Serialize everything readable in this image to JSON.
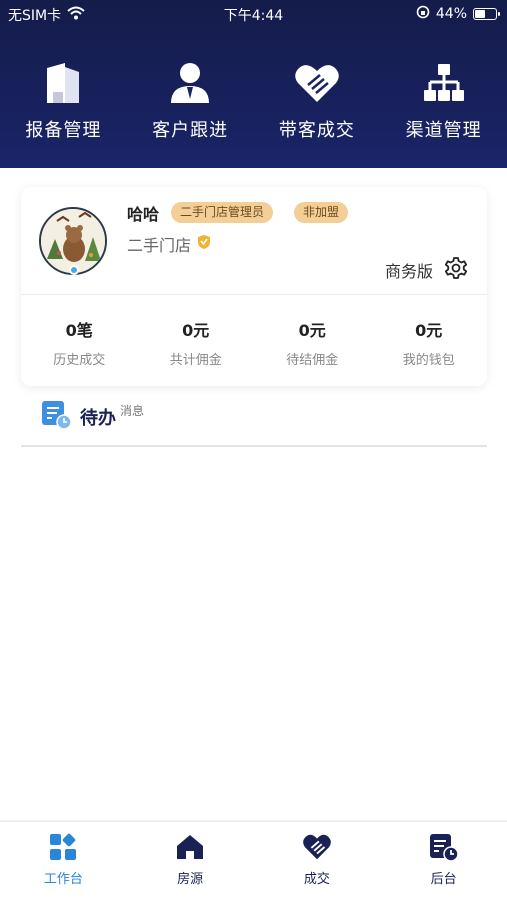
{
  "status_bar": {
    "carrier": "无SIM卡",
    "time": "下午4:44",
    "battery": "44%",
    "battery_level": 0.44
  },
  "quick_actions": [
    {
      "label": "报备管理",
      "icon": "building-icon"
    },
    {
      "label": "客户跟进",
      "icon": "person-icon"
    },
    {
      "label": "带客成交",
      "icon": "handshake-heart-icon"
    },
    {
      "label": "渠道管理",
      "icon": "hierarchy-icon"
    }
  ],
  "profile": {
    "name": "哈哈",
    "tags": [
      "二手门店管理员",
      "非加盟"
    ],
    "shop": "二手门店",
    "edition": "商务版",
    "tag_color": "#f3ce96"
  },
  "stats": [
    {
      "value": "0笔",
      "label": "历史成交"
    },
    {
      "value": "0元",
      "label": "共计佣金"
    },
    {
      "value": "0元",
      "label": "待结佣金"
    },
    {
      "value": "0元",
      "label": "我的钱包"
    }
  ],
  "todo": {
    "title": "待办",
    "subtitle": "消息"
  },
  "tabbar": [
    {
      "label": "工作台",
      "icon": "dashboard-icon",
      "active": true
    },
    {
      "label": "房源",
      "icon": "house-icon",
      "active": false
    },
    {
      "label": "成交",
      "icon": "handshake-icon",
      "active": false
    },
    {
      "label": "后台",
      "icon": "backend-icon",
      "active": false
    }
  ],
  "colors": {
    "header": "#141c4a",
    "accent": "#2a86d6",
    "navy": "#1a2155"
  }
}
